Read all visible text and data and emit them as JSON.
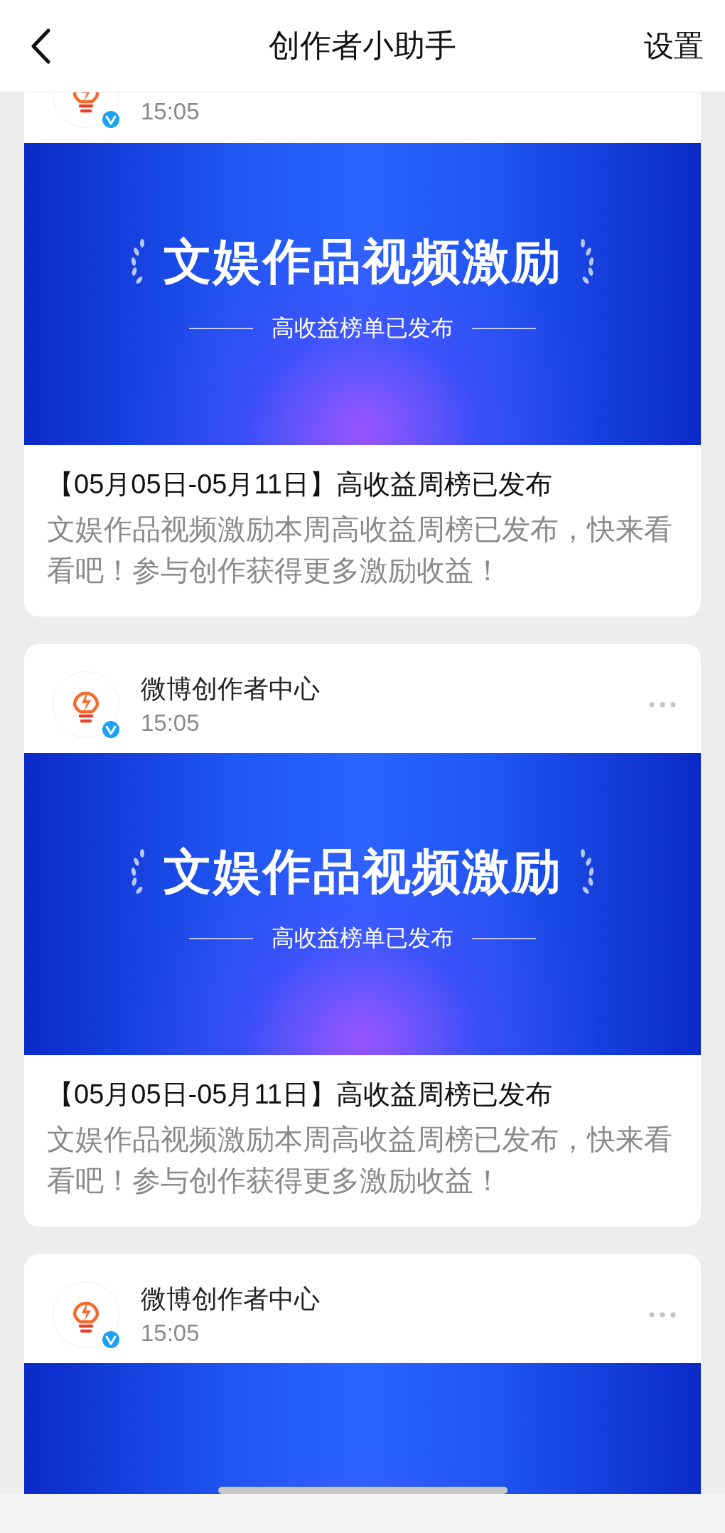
{
  "header": {
    "title": "创作者小助手",
    "action": "设置"
  },
  "cards": [
    {
      "time": "15:05",
      "verified": true,
      "banner": {
        "title": "文娱作品视频激励",
        "subtitle": "高收益榜单已发布"
      },
      "headline": "【05月05日-05月11日】高收益周榜已发布",
      "summary": "文娱作品视频激励本周高收益周榜已发布，快来看看吧！参与创作获得更多激励收益！"
    },
    {
      "sender": "微博创作者中心",
      "time": "15:05",
      "verified": true,
      "banner": {
        "title": "文娱作品视频激励",
        "subtitle": "高收益榜单已发布"
      },
      "headline": "【05月05日-05月11日】高收益周榜已发布",
      "summary": "文娱作品视频激励本周高收益周榜已发布，快来看看吧！参与创作获得更多激励收益！"
    },
    {
      "sender": "微博创作者中心",
      "time": "15:05",
      "verified": true
    }
  ]
}
